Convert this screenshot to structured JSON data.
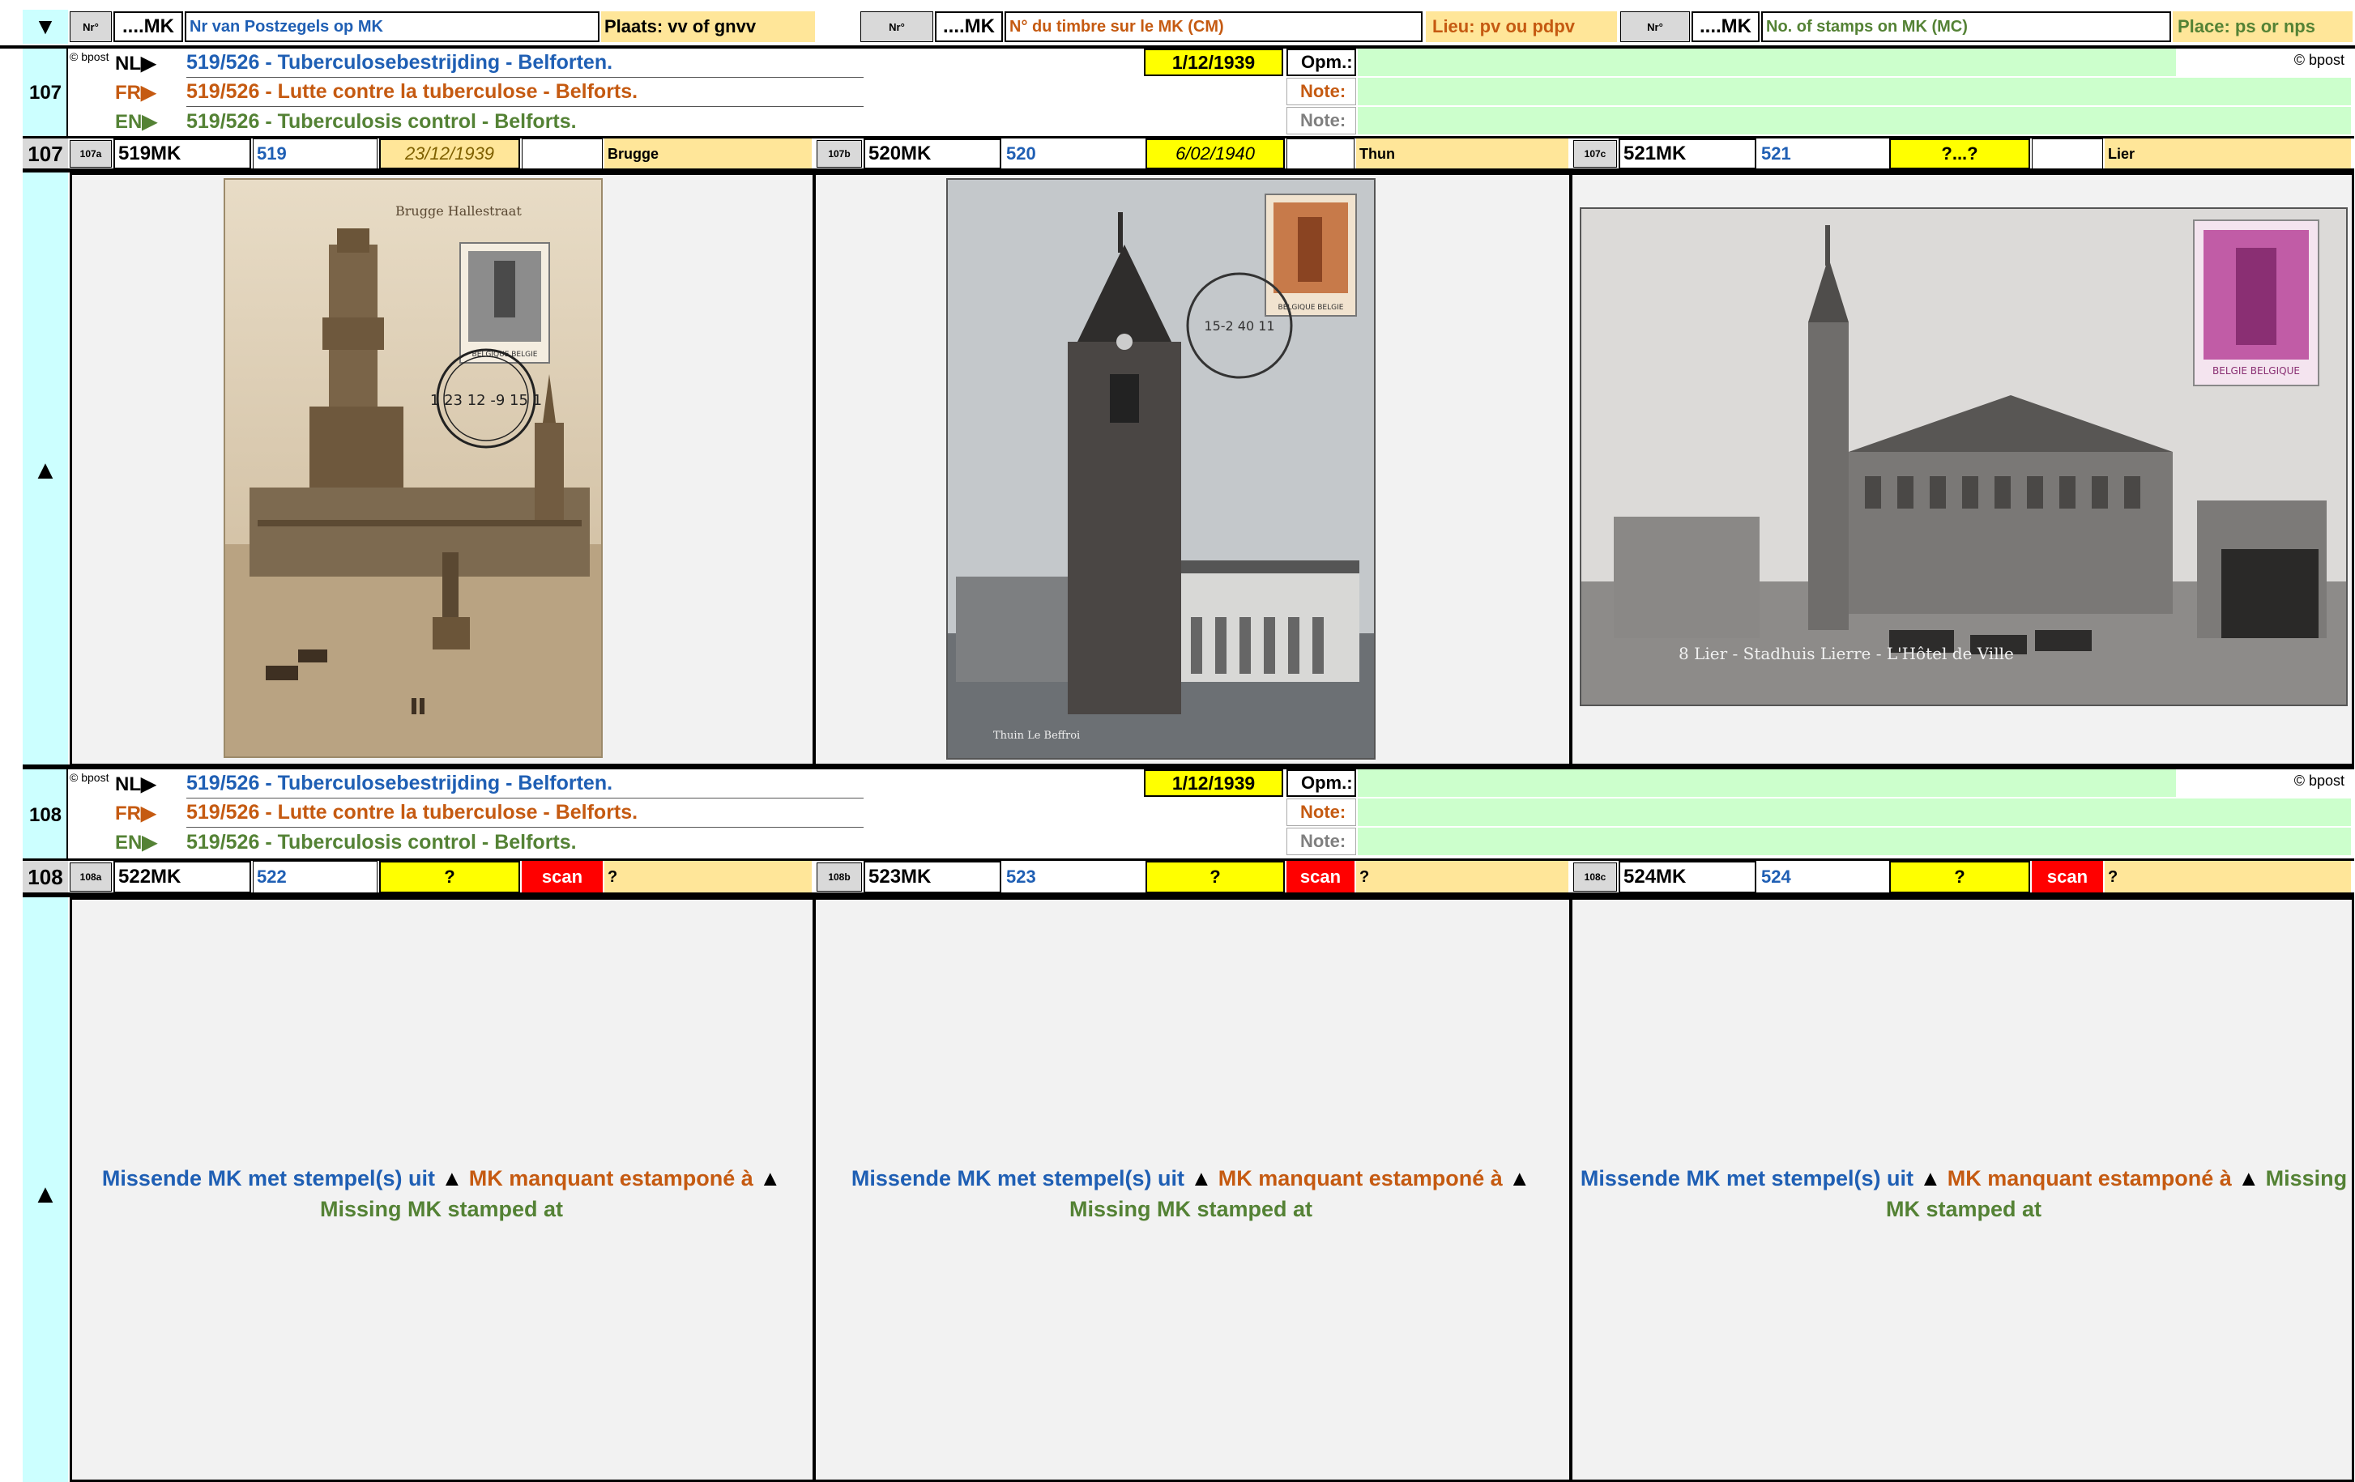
{
  "header": {
    "toggle_icon": "triangle-down-icon",
    "groups": [
      {
        "nr": "Nr°",
        "mk": "....MK",
        "desc": "Nr van Postzegels op MK",
        "place": "Plaats: vv of gnvv"
      },
      {
        "nr": "Nr°",
        "mk": "....MK",
        "desc": "N° du timbre sur le MK (CM)",
        "place": "Lieu: pv ou pdpv"
      },
      {
        "nr": "Nr°",
        "mk": "....MK",
        "desc": "No. of stamps on MK (MC)",
        "place": "Place: ps or nps"
      }
    ]
  },
  "sections": [
    {
      "number": "107",
      "source_small": "© bpost",
      "copyright": "© bpost",
      "titles": {
        "nl_tag": "NL▶",
        "nl": "519/526 - Tuberculosebestrijding - Belforten.",
        "fr_tag": "FR▶",
        "fr": "519/526 - Lutte contre la tuberculose - Belforts.",
        "en_tag": "EN▶",
        "en": "519/526 - Tuberculosis control - Belforts."
      },
      "date": "1/12/1939",
      "notes": {
        "opm": "Opm.:",
        "note_fr": "Note:",
        "note_en": "Note:"
      },
      "entries": [
        {
          "sub": "107a",
          "mk": "519MK",
          "stamp": "519",
          "date": "23/12/1939",
          "extra": "",
          "place": "Brugge"
        },
        {
          "sub": "107b",
          "mk": "520MK",
          "stamp": "520",
          "date": "6/02/1940",
          "extra": "",
          "place": "Thun"
        },
        {
          "sub": "107c",
          "mk": "521MK",
          "stamp": "521",
          "date": "?...?",
          "extra": "",
          "place": "Lier"
        }
      ],
      "expand_icon": "triangle-up-icon",
      "cards": [
        {
          "caption": "Brugge  Hallestraat",
          "postmark": "1 23 12 -9 15 1",
          "stamp_text": "BELGIQUE BELGIE"
        },
        {
          "caption": "Thuin  Le Beffroi",
          "postmark": "15-2 40 11",
          "stamp_text": "BELGIQUE BELGIE"
        },
        {
          "caption": "8 Lier - Stadhuis  Lierre - L'Hôtel de Ville",
          "postmark": "",
          "stamp_text": "BELGIE BELGIQUE"
        }
      ]
    },
    {
      "number": "108",
      "source_small": "© bpost",
      "copyright": "© bpost",
      "titles": {
        "nl_tag": "NL▶",
        "nl": "519/526 - Tuberculosebestrijding - Belforten.",
        "fr_tag": "FR▶",
        "fr": "519/526 - Lutte contre la tuberculose - Belforts.",
        "en_tag": "EN▶",
        "en": "519/526 - Tuberculosis control - Belforts."
      },
      "date": "1/12/1939",
      "notes": {
        "opm": "Opm.:",
        "note_fr": "Note:",
        "note_en": "Note:"
      },
      "entries": [
        {
          "sub": "108a",
          "mk": "522MK",
          "stamp": "522",
          "date": "?",
          "extra": "scan",
          "place": "?"
        },
        {
          "sub": "108b",
          "mk": "523MK",
          "stamp": "523",
          "date": "?",
          "extra": "scan",
          "place": "?"
        },
        {
          "sub": "108c",
          "mk": "524MK",
          "stamp": "524",
          "date": "?",
          "extra": "scan",
          "place": "?"
        }
      ],
      "expand_icon": "triangle-up-icon",
      "missing": {
        "nl": "Missende MK met stempel(s) uit",
        "sep": "▲",
        "fr": "MK manquant estamponé à",
        "en": "Missing MK stamped at"
      }
    }
  ]
}
